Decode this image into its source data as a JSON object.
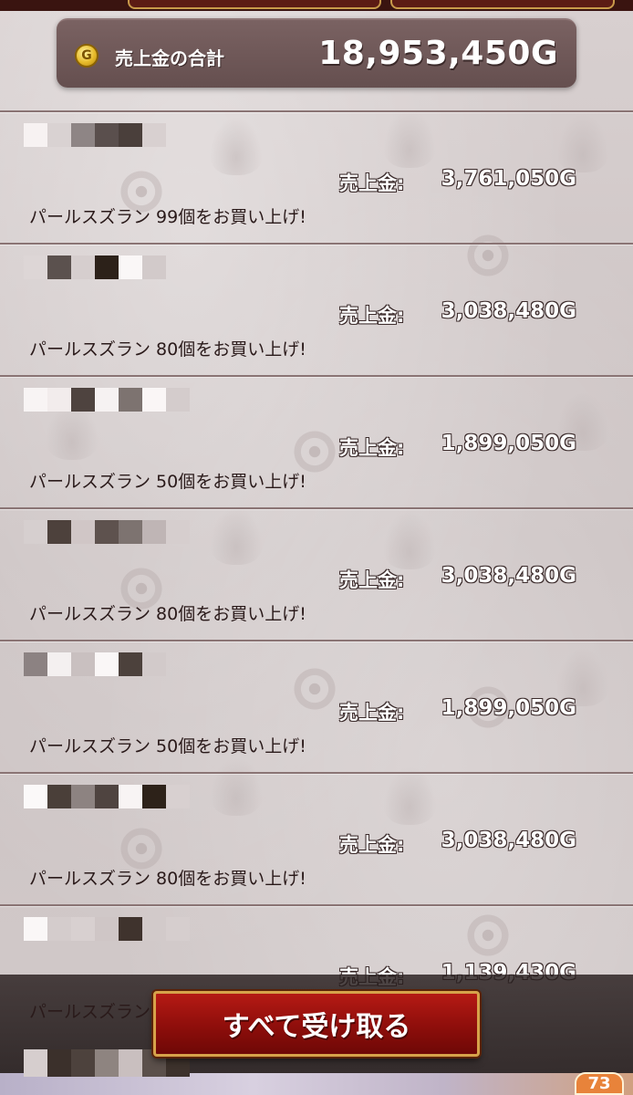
{
  "header": {
    "total_label": "売上金の合計",
    "total_value": "18,953,450G",
    "coin_symbol": "G"
  },
  "sales": [
    {
      "price_label": "売上金:",
      "price": "3,761,050G",
      "message": "パールスズラン 99個をお買い上げ!"
    },
    {
      "price_label": "売上金:",
      "price": "3,038,480G",
      "message": "パールスズラン 80個をお買い上げ!"
    },
    {
      "price_label": "売上金:",
      "price": "1,899,050G",
      "message": "パールスズラン 50個をお買い上げ!"
    },
    {
      "price_label": "売上金:",
      "price": "3,038,480G",
      "message": "パールスズラン 80個をお買い上げ!"
    },
    {
      "price_label": "売上金:",
      "price": "1,899,050G",
      "message": "パールスズラン 50個をお買い上げ!"
    },
    {
      "price_label": "売上金:",
      "price": "3,038,480G",
      "message": "パールスズラン 80個をお買い上げ!"
    },
    {
      "price_label": "売上金:",
      "price": "1,139,430G",
      "message": ""
    }
  ],
  "footer": {
    "partial_message": "パールスズラン",
    "receive_all_button": "すべて受け取る",
    "badge_count": "73"
  },
  "colors": {
    "button_red": "#9e1410",
    "button_border": "#d6a24a",
    "header_bg": "#6e5858",
    "badge_orange": "#e8833a"
  }
}
